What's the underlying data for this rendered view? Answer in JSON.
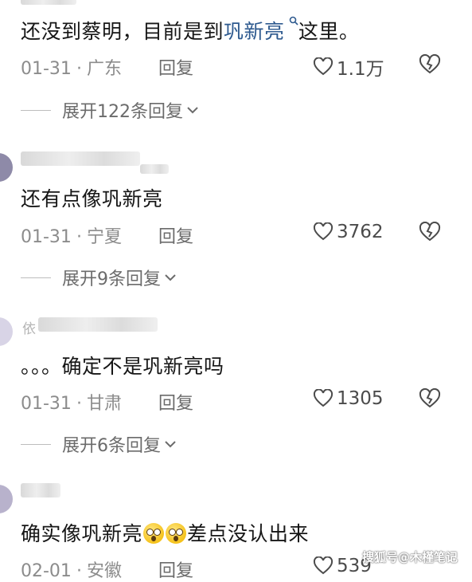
{
  "comments": [
    {
      "text_before": "还没到蔡明，目前是到",
      "link": "巩新亮",
      "text_after": "这里。",
      "date": "01-31",
      "region": "广东",
      "reply_label": "回复",
      "likes": "1.1万",
      "expand": "展开122条回复"
    },
    {
      "text": "还有点像巩新亮",
      "date": "01-31",
      "region": "宁夏",
      "reply_label": "回复",
      "likes": "3762",
      "expand": "展开9条回复"
    },
    {
      "name_initial": "依",
      "text": "。。。确定不是巩新亮吗",
      "date": "01-31",
      "region": "甘肃",
      "reply_label": "回复",
      "likes": "1305",
      "expand": "展开6条回复"
    },
    {
      "text_before": "确实像巩新亮",
      "text_after": "差点没认出来",
      "date": "02-01",
      "region": "安徽",
      "reply_label": "回复",
      "likes": "539"
    }
  ],
  "watermark": "搜狐号@木槿笔记",
  "icons": {
    "search": "search-icon",
    "like": "heart-icon",
    "dislike": "broken-heart-icon",
    "expand": "chevron-down-icon"
  },
  "colors": {
    "link": "#2e5a8f",
    "meta": "#8c8c8c"
  }
}
